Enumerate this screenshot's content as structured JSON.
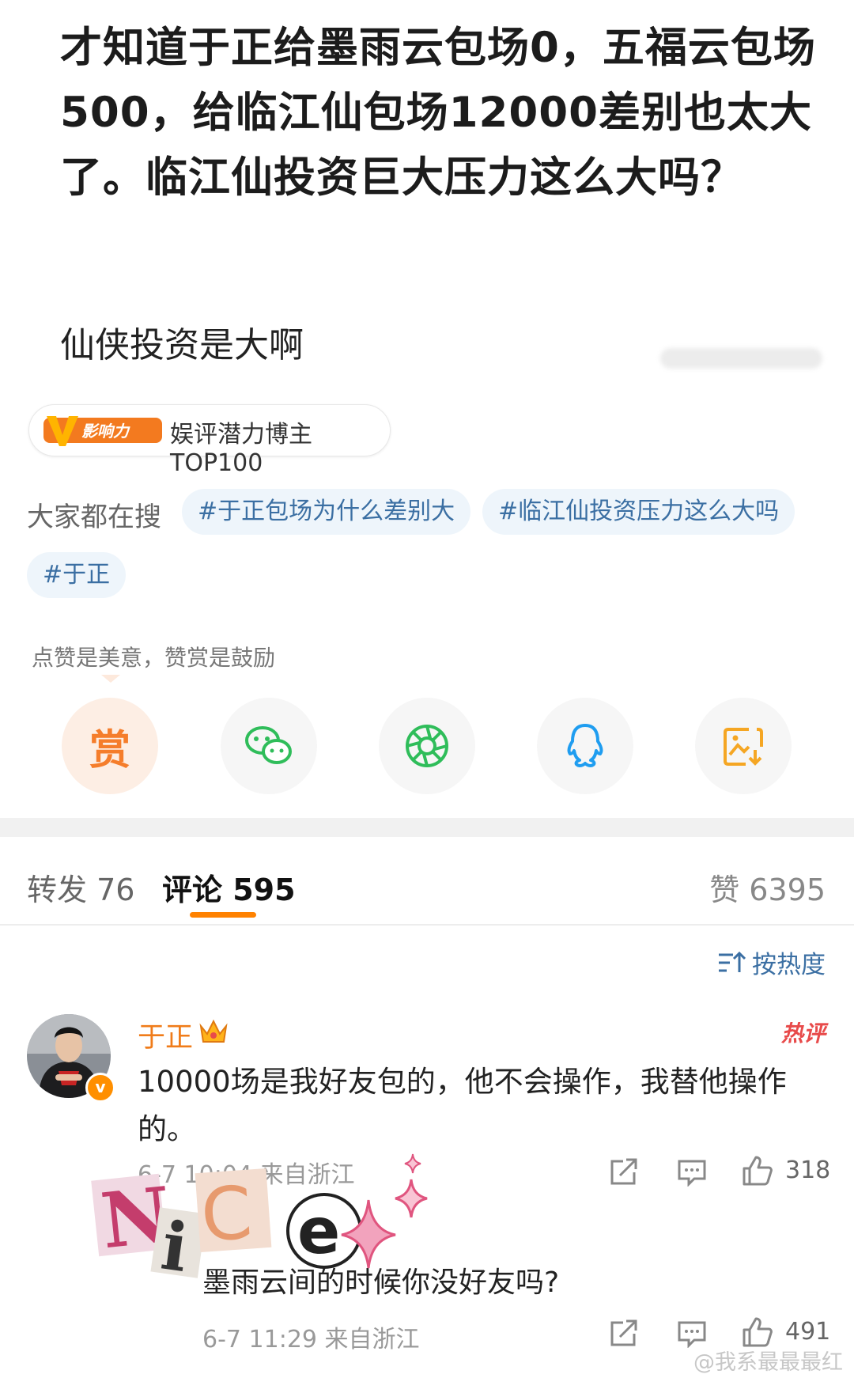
{
  "post": {
    "text": "才知道于正给墨雨云包场0，五福云包场500，给临江仙包场12000差别也太大了。临江仙投资巨大压力这么大吗？",
    "subtext": "仙侠投资是大啊"
  },
  "badge": {
    "logo_text": "影响力",
    "logo_letter": "V",
    "label": "娱评潜力博主TOP100"
  },
  "search": {
    "label": "大家都在搜",
    "tags": [
      "#于正包场为什么差别大",
      "#临江仙投资压力这么大吗",
      "#于正"
    ]
  },
  "reward": {
    "hint": "点赞是美意，赞赏是鼓励",
    "reward_char": "赏"
  },
  "share_icons": [
    "reward-icon",
    "wechat-icon",
    "moments-icon",
    "qq-icon",
    "save-image-icon"
  ],
  "tabs": {
    "repost": "转发 76",
    "comment": "评论 595",
    "like": "赞 6395"
  },
  "sort": {
    "label": "按热度"
  },
  "comments": [
    {
      "name": "于正",
      "hot": "热评",
      "text": "10000场是我好友包的，他不会操作，我替他操作的。",
      "meta": "6-7 10:04 来自浙江",
      "likes": "318"
    },
    {
      "text": "墨雨云间的时候你没好友吗?",
      "meta": "6-7 11:29 来自浙江",
      "likes": "491"
    }
  ],
  "sticker": {
    "letters": [
      "N",
      "i",
      "C",
      "e"
    ]
  },
  "watermark": "@我系最最最红",
  "colors": {
    "accent": "#ff8200",
    "link": "#3b6fa3",
    "tag_bg": "#eef5fb",
    "hot": "#e84a4a"
  }
}
